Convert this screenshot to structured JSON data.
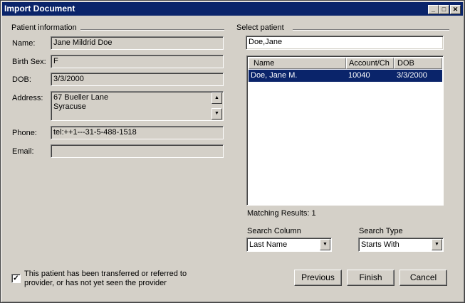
{
  "window": {
    "title": "Import Document"
  },
  "patient_info": {
    "group_label": "Patient information",
    "name_label": "Name:",
    "name_value": "Jane Mildrid Doe",
    "birth_sex_label": "Birth Sex:",
    "birth_sex_value": "F",
    "dob_label": "DOB:",
    "dob_value": "3/3/2000",
    "address_label": "Address:",
    "address_value": "67 Bueller Lane\nSyracuse",
    "phone_label": "Phone:",
    "phone_value": "tel:++1---31-5-488-1518",
    "email_label": "Email:",
    "email_value": ""
  },
  "select_patient": {
    "group_label": "Select patient",
    "search_value": "Doe,Jane",
    "columns": [
      "Name",
      "Account/Ch",
      "DOB"
    ],
    "rows": [
      {
        "name": "Doe, Jane M.",
        "account": "10040",
        "dob": "3/3/2000"
      }
    ],
    "matching_results": "Matching Results: 1",
    "search_column_label": "Search Column",
    "search_column_value": "Last Name",
    "search_type_label": "Search Type",
    "search_type_value": "Starts With"
  },
  "transfer_checkbox": {
    "checked": true,
    "label_line1": "This patient has been transferred or referred to",
    "label_line2": "provider, or has not yet seen the provider"
  },
  "buttons": {
    "previous": "Previous",
    "finish": "Finish",
    "cancel": "Cancel"
  }
}
